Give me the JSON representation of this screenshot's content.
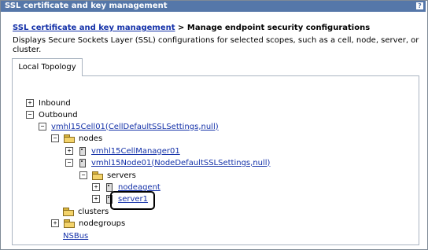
{
  "window": {
    "title": "SSL certificate and key management",
    "help": "?"
  },
  "breadcrumb": {
    "link": "SSL certificate and key management",
    "separator": ">",
    "current": "Manage endpoint security configurations"
  },
  "description": "Displays Secure Sockets Layer (SSL) configurations for selected scopes, such as a cell, node, server, or cluster.",
  "tab": {
    "label": "Local Topology"
  },
  "tree": {
    "inbound": "Inbound",
    "outbound": "Outbound",
    "cell": "vmhl15Cell01(CellDefaultSSLSettings,null)",
    "nodes": "nodes",
    "cell_manager": "vmhl15CellManager01",
    "node": "vmhl15Node01(NodeDefaultSSLSettings,null)",
    "servers": "servers",
    "nodeagent": "nodeagent",
    "server1": "server1",
    "clusters": "clusters",
    "nodegroups": "nodegroups",
    "nsbus": "NSBus"
  },
  "toggles": {
    "plus": "+",
    "minus": "−"
  }
}
